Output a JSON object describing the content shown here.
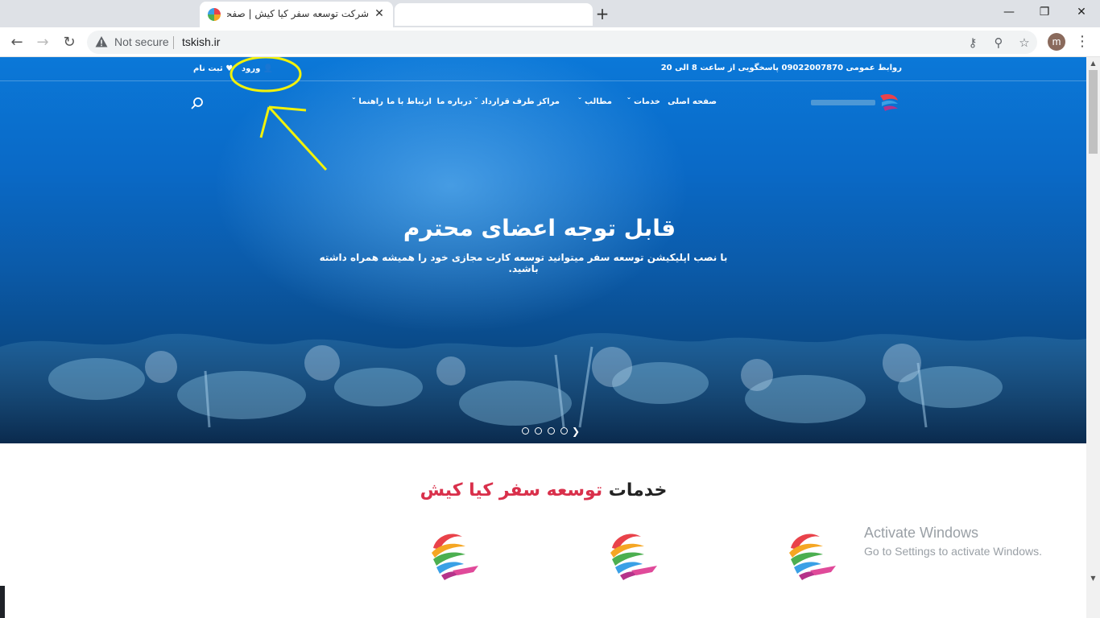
{
  "browser": {
    "tab_title": "شرکت توسعه سفر کیا کیش | صفحه",
    "close_tab": "✕",
    "new_tab": "+",
    "not_secure": "Not secure",
    "url": "tskish.ir",
    "profile_initial": "m",
    "window_minimize": "—",
    "window_restore": "❐",
    "window_close": "✕"
  },
  "site": {
    "topbar_phone": "روابط عمومی 09022007870 پاسخگویی از ساعت 8 الی 20",
    "login": "ورود",
    "signup": "ثبت نام",
    "nav": [
      {
        "label": "صفحه اصلی",
        "has_dropdown": false
      },
      {
        "label": "خدمات",
        "has_dropdown": true
      },
      {
        "label": "مطالب",
        "has_dropdown": true
      },
      {
        "label": "مراکز طرف قرارداد",
        "has_dropdown": true
      },
      {
        "label": "درباره ما",
        "has_dropdown": false
      },
      {
        "label": "ارتباط با ما",
        "has_dropdown": false
      },
      {
        "label": "راهنما",
        "has_dropdown": true
      }
    ],
    "hero_title": "قابل توجه اعضای محترم",
    "hero_subtitle": "با نصب اپلیکیشن توسعه سفر میتوانید توسعه کارت مجازی خود را همیشه همراه داشته باشید.",
    "slider_dots": 4,
    "services_title_dark": "خدمات",
    "services_title_red": "توسعه سفر کیا کیش"
  },
  "watermark": {
    "title": "Activate Windows",
    "subtitle": "Go to Settings to activate Windows."
  },
  "colors": {
    "accent_red": "#d9304b",
    "annotation_yellow": "#f2f20a",
    "hero_blue": "#0b6fcf"
  }
}
